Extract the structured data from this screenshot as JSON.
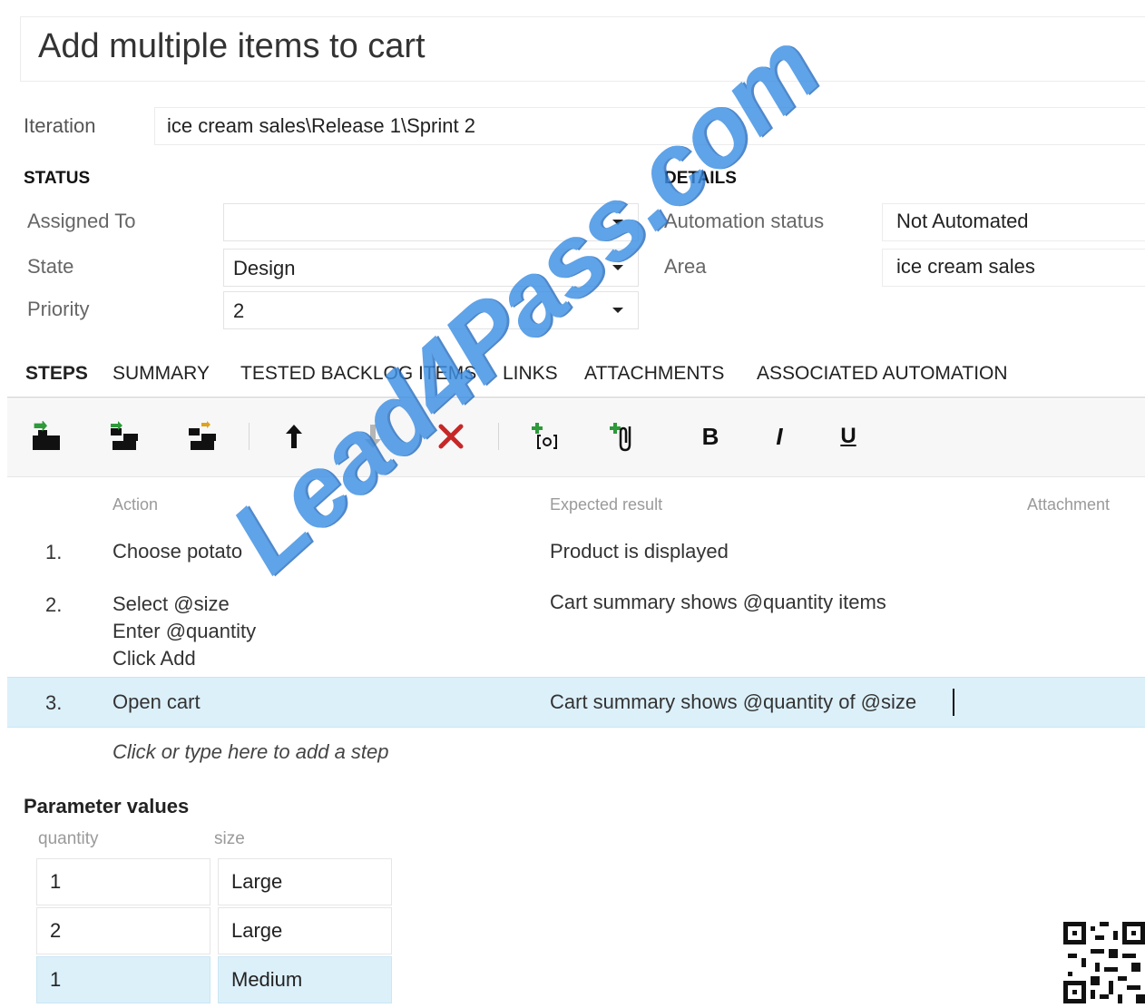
{
  "work_item": {
    "title": "Add multiple items to cart",
    "iteration_label": "Iteration",
    "iteration_value": "ice cream sales\\Release 1\\Sprint 2"
  },
  "status": {
    "heading": "STATUS",
    "assigned_to_label": "Assigned To",
    "assigned_to_value": "",
    "state_label": "State",
    "state_value": "Design",
    "priority_label": "Priority",
    "priority_value": "2"
  },
  "details": {
    "heading": "DETAILS",
    "automation_label": "Automation status",
    "automation_value": "Not Automated",
    "area_label": "Area",
    "area_value": "ice cream sales"
  },
  "tabs": [
    {
      "label": "STEPS",
      "active": true
    },
    {
      "label": "SUMMARY",
      "active": false
    },
    {
      "label": "TESTED BACKLOG ITEMS",
      "active": false
    },
    {
      "label": "LINKS",
      "active": false
    },
    {
      "label": "ATTACHMENTS",
      "active": false
    },
    {
      "label": "ASSOCIATED AUTOMATION",
      "active": false
    }
  ],
  "toolbar": {
    "icons": [
      "insert-step-icon",
      "insert-shared-steps-icon",
      "create-shared-steps-icon",
      "move-up-icon",
      "move-down-icon",
      "delete-step-icon",
      "insert-parameter-icon",
      "attach-file-icon",
      "bold-icon",
      "italic-icon",
      "underline-icon"
    ],
    "bold_glyph": "B",
    "italic_glyph": "I",
    "underline_glyph": "U",
    "delete_color": "#c62828"
  },
  "steps_table": {
    "col_action": "Action",
    "col_expected": "Expected result",
    "col_attachment": "Attachment",
    "rows": [
      {
        "num": "1.",
        "action": "Choose potato",
        "expected": "Product is displayed"
      },
      {
        "num": "2.",
        "action": "Select @size\nEnter @quantity\nClick Add",
        "expected": "Cart summary shows @quantity items"
      },
      {
        "num": "3.",
        "action": "Open cart",
        "expected": "Cart summary shows @quantity of @size"
      }
    ],
    "add_step_hint": "Click or type here to add a step"
  },
  "parameters": {
    "heading": "Parameter values",
    "columns": [
      "quantity",
      "size"
    ],
    "rows": [
      {
        "quantity": "1",
        "size": "Large"
      },
      {
        "quantity": "2",
        "size": "Large"
      },
      {
        "quantity": "1",
        "size": "Medium"
      }
    ]
  },
  "watermark": "Lead4Pass.com",
  "colors": {
    "highlight": "#dcf0fa",
    "watermark": "#3d8fe3"
  }
}
